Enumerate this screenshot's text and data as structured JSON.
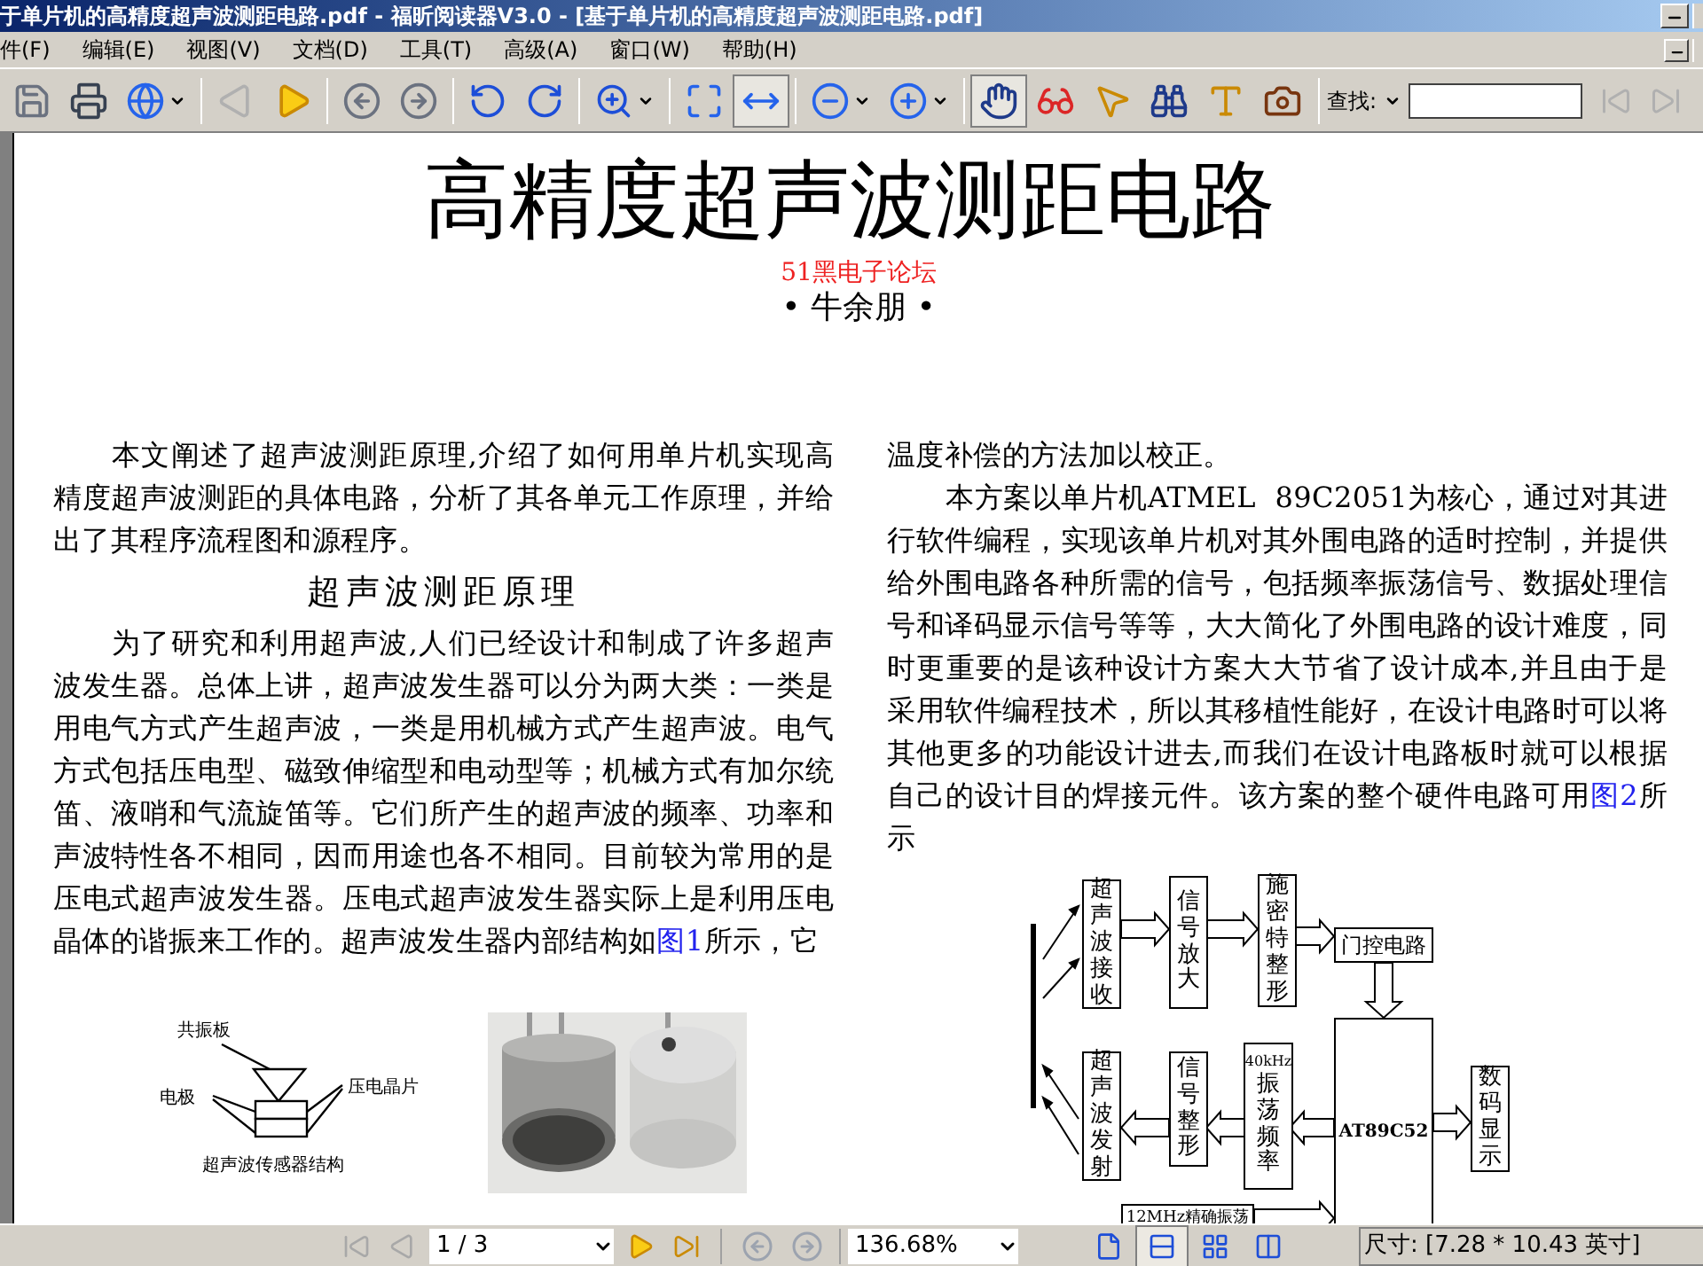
{
  "window": {
    "title": "于单片机的高精度超声波测距电路.pdf - 福昕阅读器V3.0 - [基于单片机的高精度超声波测距电路.pdf]"
  },
  "menu": [
    "件(F)",
    "编辑(E)",
    "视图(V)",
    "文档(D)",
    "工具(T)",
    "高级(A)",
    "窗口(W)",
    "帮助(H)"
  ],
  "toolbar": {
    "buttons": [
      {
        "selected": false,
        "disabled": false
      },
      {
        "selected": false,
        "disabled": false
      },
      {
        "selected": false,
        "disabled": false
      },
      {
        "selected": false,
        "disabled": true
      },
      {
        "selected": false,
        "disabled": false
      },
      {
        "selected": false,
        "disabled": false
      },
      {
        "selected": false,
        "disabled": false
      },
      {
        "selected": false,
        "disabled": false
      },
      {
        "selected": false,
        "disabled": false
      },
      {
        "selected": false,
        "disabled": false
      },
      {
        "selected": false,
        "disabled": false
      },
      {
        "selected": true,
        "disabled": false
      },
      {
        "selected": false,
        "disabled": false
      },
      {
        "selected": false,
        "disabled": false
      },
      {
        "selected": true,
        "disabled": false
      },
      {
        "selected": false,
        "disabled": false
      },
      {
        "selected": false,
        "disabled": false
      },
      {
        "selected": false,
        "disabled": false
      },
      {
        "selected": false,
        "disabled": false
      },
      {
        "selected": false,
        "disabled": false
      }
    ],
    "find_label": "查找:",
    "find_buttons": [
      {
        "disabled": true
      },
      {
        "disabled": true
      }
    ]
  },
  "document": {
    "title": "高精度超声波测距电路",
    "source": "51黑电子论坛",
    "author": "• 牛余朋 •",
    "left_column": [
      {
        "kind": "paragraph",
        "indent": true,
        "parts": [
          {
            "kind": "text",
            "text": "本文阐述了超声波测距原理,介绍了如何用单片机实现高精度超声波测距的具体电路，分析了其各单元工作原理，并给出了其程序流程图和源程序。"
          }
        ]
      },
      {
        "kind": "heading",
        "text": "超声波测距原理"
      },
      {
        "kind": "paragraph",
        "indent": true,
        "parts": [
          {
            "kind": "text",
            "text": "为了研究和利用超声波,人们已经设计和制成了许多超声波发生器。总体上讲，超声波发生器可以分为两大类：一类是用电气方式产生超声波，一类是用机械方式产生超声波。电气方式包括压电型、磁致伸缩型和电动型等；机械方式有加尔统笛、液哨和气流旋笛等。它们所产生的超声波的频率、功率和声波特性各不相同，因而用途也各不相同。目前较为常用的是压电式超声波发生器。压电式超声波发生器实际上是利用压电晶体的谐振来工作的。超声波发生器内部结构如"
          },
          {
            "kind": "link",
            "text": "图1"
          },
          {
            "kind": "text",
            "text": "所示，它"
          }
        ]
      }
    ],
    "right_column": [
      {
        "kind": "paragraph",
        "indent": false,
        "parts": [
          {
            "kind": "text",
            "text": "温度补偿的方法加以校正。"
          }
        ]
      },
      {
        "kind": "paragraph",
        "indent": true,
        "parts": [
          {
            "kind": "text",
            "text": "本方案以单片机ATMEL  89C2051为核心，通过对其进行软件编程，实现该单片机对其外围电路的适时控制，并提供给外围电路各种所需的信号，包括频率振荡信号、数据处理信号和译码显示信号等等，大大简化了外围电路的设计难度，同时更重要的是该种设计方案大大节省了设计成本,并且由于是采用软件编程技术，所以其移植性能好，在设计电路时可以将其他更多的功能设计进去,而我们在设计电路板时就可以根据自己的设计目的焊接元件。该方案的整个硬件电路可用"
          },
          {
            "kind": "link",
            "text": "图2"
          },
          {
            "kind": "text",
            "text": "所示"
          }
        ]
      }
    ],
    "sensor_figure": {
      "labels": [
        "共振板",
        "电极",
        "压电晶片"
      ],
      "caption": "超声波传感器结构"
    },
    "diagram": {
      "nodes": [
        {
          "label": "超声波接收"
        },
        {
          "label": "信号放大"
        },
        {
          "label": "施密特整形"
        },
        {
          "label": "门控电路"
        },
        {
          "label": "AT89C52"
        },
        {
          "label": "超声波发射"
        },
        {
          "label": "信号整形"
        },
        {
          "label": "振荡频率",
          "note": "40kHz"
        },
        {
          "label": "数码显示"
        },
        {
          "label": "12MHz精确振荡"
        }
      ]
    }
  },
  "status_bar": {
    "page": "1 / 3",
    "zoom": "136.68%",
    "size": "尺寸: [7.28 * 10.43 英寸]",
    "nav_buttons": [
      {
        "disabled": true
      },
      {
        "disabled": true
      },
      {
        "disabled": false
      },
      {
        "disabled": false
      }
    ],
    "layouts": [
      {
        "selected": false
      },
      {
        "selected": true
      },
      {
        "selected": false
      },
      {
        "selected": false
      }
    ]
  }
}
